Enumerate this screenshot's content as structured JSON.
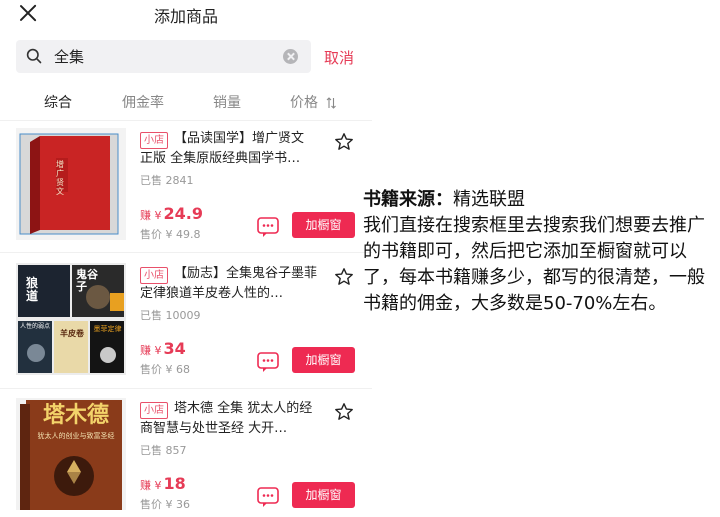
{
  "header": {
    "title": "添加商品"
  },
  "search": {
    "value": "全集",
    "cancel_label": "取消"
  },
  "tabs": [
    {
      "label": "综合",
      "active": true
    },
    {
      "label": "佣金率",
      "active": false
    },
    {
      "label": "销量",
      "active": false
    },
    {
      "label": "价格",
      "active": false
    }
  ],
  "items": [
    {
      "shop_tag": "小店",
      "title": "【品读国学】增广贤文 正版 全集原版经典国学书…",
      "sold": "已售 2841",
      "earn_prefix": "赚 ¥",
      "earn_amount": "24.9",
      "price": "售价 ¥ 49.8",
      "add_label": "加橱窗",
      "cover_text": "增广贤文"
    },
    {
      "shop_tag": "小店",
      "title": "【励志】全集鬼谷子墨菲定律狼道羊皮卷人性的…",
      "sold": "已售 10009",
      "earn_prefix": "赚 ¥",
      "earn_amount": "34",
      "price": "售价 ¥ 68",
      "add_label": "加橱窗",
      "cover_books": [
        "狼道",
        "鬼谷子",
        "人性的弱点",
        "羊皮卷",
        "墨菲定律"
      ]
    },
    {
      "shop_tag": "小店",
      "title": "塔木德 全集  犹太人的经商智慧与处世圣经 大开…",
      "sold": "已售 857",
      "earn_prefix": "赚 ¥",
      "earn_amount": "18",
      "price": "售价 ¥ 36",
      "add_label": "加橱窗",
      "cover_title": "塔木德",
      "cover_subtitle": "犹太人的创业与致富圣经"
    }
  ],
  "info": {
    "source_label": "书籍来源：",
    "source_value": "精选联盟",
    "body": "我们直接在搜索框里去搜索我们想要去推广的书籍即可，然后把它添加至橱窗就可以了，每本书籍赚多少，都写的很清楚，一般书籍的佣金，大多数是50-70%左右。"
  },
  "colors": {
    "accent": "#ee2a52",
    "price_red": "#e63b56"
  }
}
